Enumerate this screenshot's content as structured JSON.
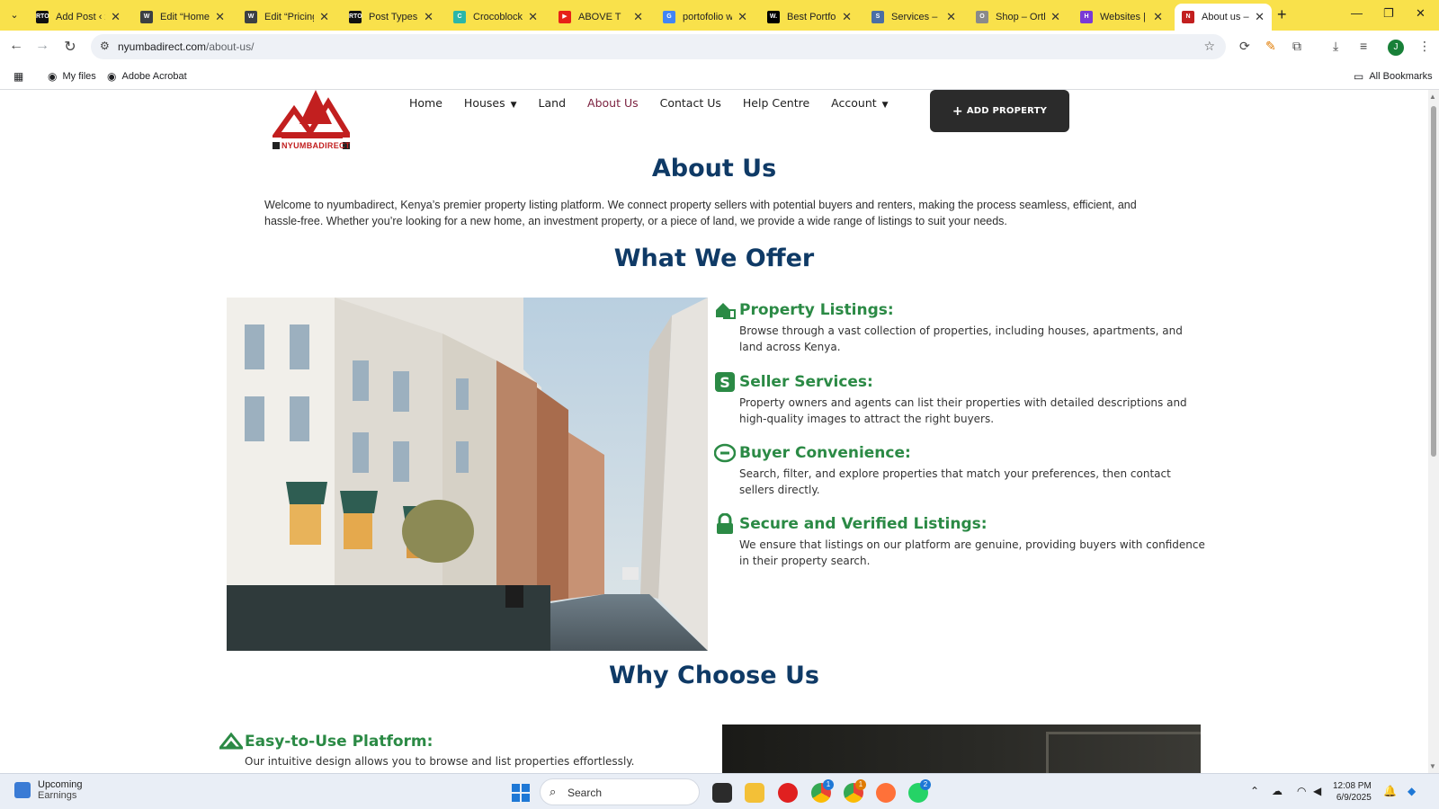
{
  "browser": {
    "tabs": [
      {
        "title": "Add Post ‹ xp",
        "fav_color": "#111111",
        "fav_text": "RTO"
      },
      {
        "title": "Edit “Home”",
        "fav_color": "#3c4043",
        "fav_text": "W"
      },
      {
        "title": "Edit “Pricing”",
        "fav_color": "#3c4043",
        "fav_text": "W"
      },
      {
        "title": "Post Types ‹",
        "fav_color": "#111111",
        "fav_text": "RTO"
      },
      {
        "title": "Crocoblock",
        "fav_color": "#2bb6a8",
        "fav_text": "C"
      },
      {
        "title": "ABOVE T",
        "fav_color": "#e62117",
        "fav_text": "▶"
      },
      {
        "title": "portofolio w",
        "fav_color": "#4285f4",
        "fav_text": "G"
      },
      {
        "title": "Best Portfoli",
        "fav_color": "#000000",
        "fav_text": "W."
      },
      {
        "title": "Services – m",
        "fav_color": "#4a6fa5",
        "fav_text": "S"
      },
      {
        "title": "Shop – Orth",
        "fav_color": "#8a8a8a",
        "fav_text": "O"
      },
      {
        "title": "Websites | H",
        "fav_color": "#7a3ad6",
        "fav_text": "H"
      },
      {
        "title": "About us – N",
        "fav_color": "#c21f1f",
        "fav_text": "N"
      }
    ],
    "url_host": "nyumbadirect.com",
    "url_path": "/about-us/",
    "bookmarks": {
      "my_files": "My files",
      "adobe": "Adobe Acrobat",
      "all": "All Bookmarks"
    },
    "profile_initial": "J"
  },
  "site": {
    "logo_text": "NYUMBADIRECT",
    "nav": [
      "Home",
      "Houses",
      "Land",
      "About Us",
      "Contact Us",
      "Help Centre",
      "Account"
    ],
    "add_property": "ADD PROPERTY",
    "title": "About Us",
    "intro": "Welcome to nyumbadirect, Kenya’s premier property listing platform. We connect property sellers with potential buyers and renters, making the process seamless, efficient, and hassle-free. Whether you’re looking for a new home, an investment property, or a piece of land, we provide a wide range of listings to suit your needs.",
    "offer_title": "What We Offer",
    "features": [
      {
        "title": "Property Listings:",
        "desc": "Browse through a vast collection of properties, including houses, apartments, and land across Kenya.",
        "icon": "house-icon"
      },
      {
        "title": "Seller Services:",
        "desc": "Property owners and agents can list their properties with detailed descriptions and high-quality images to attract the right buyers.",
        "icon": "dollar-icon"
      },
      {
        "title": "Buyer Convenience:",
        "desc": "Search, filter, and explore properties that match your preferences, then contact sellers directly.",
        "icon": "sale-icon"
      },
      {
        "title": "Secure and Verified Listings:",
        "desc": "We ensure that listings on our platform are genuine, providing buyers with confidence in their property search.",
        "icon": "lock-icon"
      }
    ],
    "why_title": "Why Choose Us",
    "why_items": [
      {
        "title": "Easy-to-Use Platform:",
        "desc": "Our intuitive design allows you to browse and list properties effortlessly.",
        "icon": "ease-icon"
      }
    ],
    "colors": {
      "heading": "#0f3a66",
      "accent": "#2b8a45",
      "nav_active": "#7a1f3d",
      "button": "#2b2b2b"
    }
  },
  "taskbar": {
    "weather_title": "Upcoming",
    "weather_sub": "Earnings",
    "search": "Search",
    "time": "12:08 PM",
    "date": "6/9/2025",
    "badges": [
      "1",
      "1",
      "2"
    ]
  }
}
